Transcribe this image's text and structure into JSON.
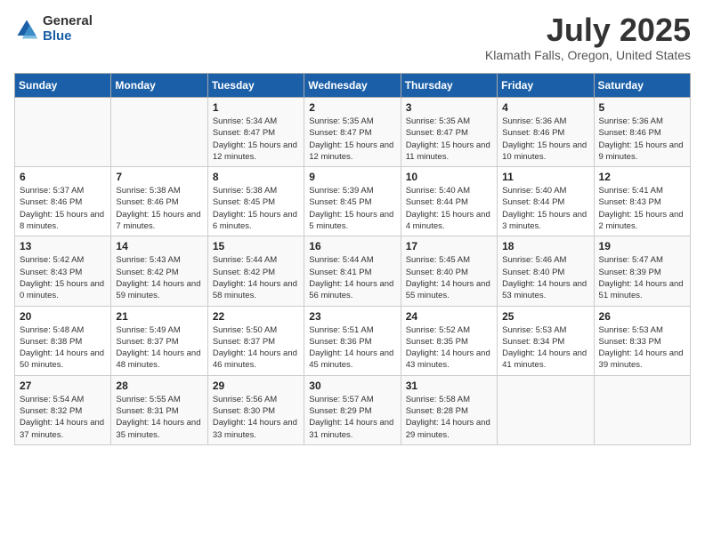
{
  "header": {
    "logo_general": "General",
    "logo_blue": "Blue",
    "month_title": "July 2025",
    "location": "Klamath Falls, Oregon, United States"
  },
  "days_of_week": [
    "Sunday",
    "Monday",
    "Tuesday",
    "Wednesday",
    "Thursday",
    "Friday",
    "Saturday"
  ],
  "weeks": [
    [
      {
        "day": "",
        "content": ""
      },
      {
        "day": "",
        "content": ""
      },
      {
        "day": "1",
        "content": "Sunrise: 5:34 AM\nSunset: 8:47 PM\nDaylight: 15 hours and 12 minutes."
      },
      {
        "day": "2",
        "content": "Sunrise: 5:35 AM\nSunset: 8:47 PM\nDaylight: 15 hours and 12 minutes."
      },
      {
        "day": "3",
        "content": "Sunrise: 5:35 AM\nSunset: 8:47 PM\nDaylight: 15 hours and 11 minutes."
      },
      {
        "day": "4",
        "content": "Sunrise: 5:36 AM\nSunset: 8:46 PM\nDaylight: 15 hours and 10 minutes."
      },
      {
        "day": "5",
        "content": "Sunrise: 5:36 AM\nSunset: 8:46 PM\nDaylight: 15 hours and 9 minutes."
      }
    ],
    [
      {
        "day": "6",
        "content": "Sunrise: 5:37 AM\nSunset: 8:46 PM\nDaylight: 15 hours and 8 minutes."
      },
      {
        "day": "7",
        "content": "Sunrise: 5:38 AM\nSunset: 8:46 PM\nDaylight: 15 hours and 7 minutes."
      },
      {
        "day": "8",
        "content": "Sunrise: 5:38 AM\nSunset: 8:45 PM\nDaylight: 15 hours and 6 minutes."
      },
      {
        "day": "9",
        "content": "Sunrise: 5:39 AM\nSunset: 8:45 PM\nDaylight: 15 hours and 5 minutes."
      },
      {
        "day": "10",
        "content": "Sunrise: 5:40 AM\nSunset: 8:44 PM\nDaylight: 15 hours and 4 minutes."
      },
      {
        "day": "11",
        "content": "Sunrise: 5:40 AM\nSunset: 8:44 PM\nDaylight: 15 hours and 3 minutes."
      },
      {
        "day": "12",
        "content": "Sunrise: 5:41 AM\nSunset: 8:43 PM\nDaylight: 15 hours and 2 minutes."
      }
    ],
    [
      {
        "day": "13",
        "content": "Sunrise: 5:42 AM\nSunset: 8:43 PM\nDaylight: 15 hours and 0 minutes."
      },
      {
        "day": "14",
        "content": "Sunrise: 5:43 AM\nSunset: 8:42 PM\nDaylight: 14 hours and 59 minutes."
      },
      {
        "day": "15",
        "content": "Sunrise: 5:44 AM\nSunset: 8:42 PM\nDaylight: 14 hours and 58 minutes."
      },
      {
        "day": "16",
        "content": "Sunrise: 5:44 AM\nSunset: 8:41 PM\nDaylight: 14 hours and 56 minutes."
      },
      {
        "day": "17",
        "content": "Sunrise: 5:45 AM\nSunset: 8:40 PM\nDaylight: 14 hours and 55 minutes."
      },
      {
        "day": "18",
        "content": "Sunrise: 5:46 AM\nSunset: 8:40 PM\nDaylight: 14 hours and 53 minutes."
      },
      {
        "day": "19",
        "content": "Sunrise: 5:47 AM\nSunset: 8:39 PM\nDaylight: 14 hours and 51 minutes."
      }
    ],
    [
      {
        "day": "20",
        "content": "Sunrise: 5:48 AM\nSunset: 8:38 PM\nDaylight: 14 hours and 50 minutes."
      },
      {
        "day": "21",
        "content": "Sunrise: 5:49 AM\nSunset: 8:37 PM\nDaylight: 14 hours and 48 minutes."
      },
      {
        "day": "22",
        "content": "Sunrise: 5:50 AM\nSunset: 8:37 PM\nDaylight: 14 hours and 46 minutes."
      },
      {
        "day": "23",
        "content": "Sunrise: 5:51 AM\nSunset: 8:36 PM\nDaylight: 14 hours and 45 minutes."
      },
      {
        "day": "24",
        "content": "Sunrise: 5:52 AM\nSunset: 8:35 PM\nDaylight: 14 hours and 43 minutes."
      },
      {
        "day": "25",
        "content": "Sunrise: 5:53 AM\nSunset: 8:34 PM\nDaylight: 14 hours and 41 minutes."
      },
      {
        "day": "26",
        "content": "Sunrise: 5:53 AM\nSunset: 8:33 PM\nDaylight: 14 hours and 39 minutes."
      }
    ],
    [
      {
        "day": "27",
        "content": "Sunrise: 5:54 AM\nSunset: 8:32 PM\nDaylight: 14 hours and 37 minutes."
      },
      {
        "day": "28",
        "content": "Sunrise: 5:55 AM\nSunset: 8:31 PM\nDaylight: 14 hours and 35 minutes."
      },
      {
        "day": "29",
        "content": "Sunrise: 5:56 AM\nSunset: 8:30 PM\nDaylight: 14 hours and 33 minutes."
      },
      {
        "day": "30",
        "content": "Sunrise: 5:57 AM\nSunset: 8:29 PM\nDaylight: 14 hours and 31 minutes."
      },
      {
        "day": "31",
        "content": "Sunrise: 5:58 AM\nSunset: 8:28 PM\nDaylight: 14 hours and 29 minutes."
      },
      {
        "day": "",
        "content": ""
      },
      {
        "day": "",
        "content": ""
      }
    ]
  ]
}
